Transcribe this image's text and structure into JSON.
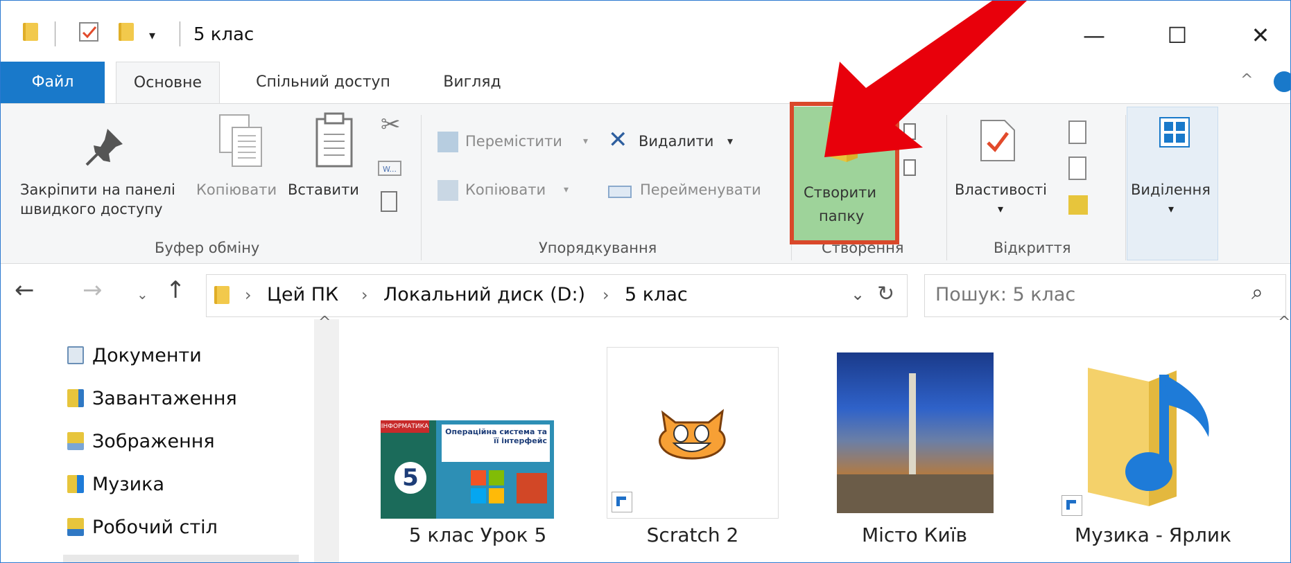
{
  "window": {
    "title": "5 клас",
    "controls": {
      "minimize": "—",
      "maximize": "☐",
      "close": "✕"
    }
  },
  "tabs": [
    "Файл",
    "Основне",
    "Спільний доступ",
    "Вигляд"
  ],
  "ribbon": {
    "clipboard": {
      "pin_line1": "Закріпити на панелі",
      "pin_line2": "швидкого доступу",
      "copy": "Копіювати",
      "paste": "Вставити",
      "group": "Буфер обміну"
    },
    "organize": {
      "move": "Перемістити",
      "copy": "Копіювати",
      "delete": "Видалити",
      "rename": "Перейменувати",
      "group": "Упорядкування"
    },
    "new": {
      "new_folder_line1": "Створити",
      "new_folder_line2": "папку",
      "group": "Створення"
    },
    "open": {
      "properties": "Властивості",
      "group": "Відкриття"
    },
    "select": {
      "selection": "Виділення"
    }
  },
  "address": {
    "crumbs": [
      "Цей ПК",
      "Локальний диск (D:)",
      "5 клас"
    ],
    "search_placeholder": "Пошук: 5 клас"
  },
  "nav_pane": {
    "items": [
      "Документи",
      "Завантаження",
      "Зображення",
      "Музика",
      "Робочий стіл"
    ]
  },
  "files": [
    {
      "name": "5 клас Урок 5",
      "book_title": "ІНФОРМАТИКА",
      "book_subtitle": "Операційна система та її інтерфейс",
      "book_number": "5"
    },
    {
      "name": "Scratch 2"
    },
    {
      "name": "Місто Київ"
    },
    {
      "name": "Музика - Ярлик"
    }
  ],
  "colors": {
    "accent": "#1979ca",
    "highlight_border": "#d9482a",
    "highlight_fill": "#9ed39a",
    "arrow": "#e8000b"
  }
}
